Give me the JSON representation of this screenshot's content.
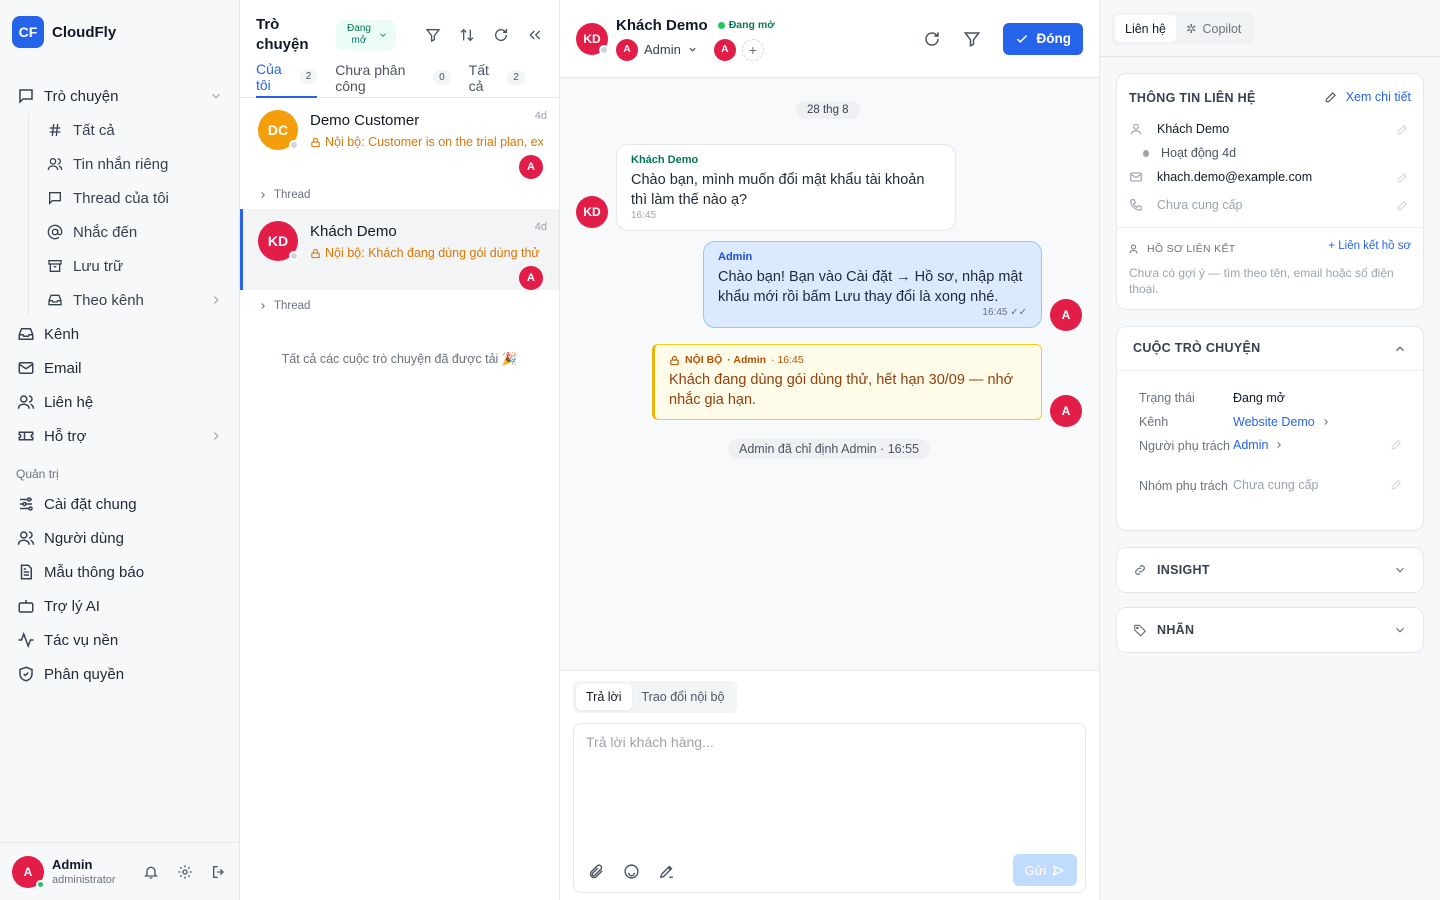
{
  "brand": {
    "logo": "CF",
    "name": "CloudFly"
  },
  "nav": {
    "conversations": "Trò chuyện",
    "sub": [
      {
        "icon": "hash-icon",
        "label": "Tất cả"
      },
      {
        "icon": "users-icon",
        "label": "Tin nhắn riêng"
      },
      {
        "icon": "thread-icon",
        "label": "Thread của tôi"
      },
      {
        "icon": "at-icon",
        "label": "Nhắc đến"
      },
      {
        "icon": "archive-icon",
        "label": "Lưu trữ"
      },
      {
        "icon": "inbox-icon",
        "label": "Theo kênh"
      }
    ],
    "items": [
      {
        "icon": "inbox-icon",
        "label": "Kênh"
      },
      {
        "icon": "mail-icon",
        "label": "Email"
      },
      {
        "icon": "contacts-icon",
        "label": "Liên hệ"
      },
      {
        "icon": "ticket-icon",
        "label": "Hỗ trợ"
      }
    ],
    "admin_section": "Quản trị",
    "admin_items": [
      {
        "icon": "sliders-icon",
        "label": "Cài đặt chung"
      },
      {
        "icon": "users-icon",
        "label": "Người dùng"
      },
      {
        "icon": "template-icon",
        "label": "Mẫu thông báo"
      },
      {
        "icon": "bot-icon",
        "label": "Trợ lý AI"
      },
      {
        "icon": "activity-icon",
        "label": "Tác vụ nền"
      },
      {
        "icon": "shield-icon",
        "label": "Phân quyền"
      }
    ]
  },
  "user": {
    "initial": "A",
    "name": "Admin",
    "role": "administrator"
  },
  "list": {
    "title": "Trò chuyện",
    "status_filter": "Đang mở",
    "tabs": [
      {
        "label": "Của tôi",
        "count": "2"
      },
      {
        "label": "Chưa phân công",
        "count": "0"
      },
      {
        "label": "Tất cả",
        "count": "2"
      }
    ],
    "conversations": [
      {
        "initials": "DC",
        "name": "Demo Customer",
        "preview": "Nội bộ: Customer is on the trial plan, ex",
        "time": "4d",
        "assignee": "A",
        "color": "#f59e0b"
      },
      {
        "initials": "KD",
        "name": "Khách Demo",
        "preview": "Nội bộ: Khách đang dùng gói dùng thử",
        "time": "4d",
        "assignee": "A",
        "color": "#e11d48"
      }
    ],
    "thread_label": "Thread",
    "all_loaded": "Tất cả các cuộc trò chuyện đã được tải 🎉"
  },
  "chat": {
    "initials": "KD",
    "name": "Khách Demo",
    "status": "Đang mở",
    "assignee_initial": "A",
    "assignee_name": "Admin",
    "participant_initial": "A",
    "close_label": "Đóng",
    "date_chip": "28 thg 8",
    "incoming": {
      "author": "Khách Demo",
      "text": "Chào bạn, mình muốn đổi mật khẩu tài khoản thì làm thế nào ạ?",
      "time": "16:45"
    },
    "outgoing": {
      "author": "Admin",
      "text": "Chào bạn! Bạn vào Cài đặt → Hồ sơ, nhập mật khẩu mới rồi bấm Lưu thay đổi là xong nhé.",
      "time": "16:45"
    },
    "note": {
      "tag": "NỘI BỘ",
      "author": "· Admin",
      "time": "· 16:45",
      "text": "Khách đang dùng gói dùng thử, hết hạn 30/09 — nhớ nhắc gia hạn."
    },
    "system": "Admin đã chỉ định Admin · 16:55",
    "composer": {
      "tab_reply": "Trả lời",
      "tab_internal": "Trao đổi nội bộ",
      "placeholder": "Trả lời khách hàng...",
      "send_label": "Gửi"
    }
  },
  "panel": {
    "tabs": [
      "Liên hệ",
      "Copilot"
    ],
    "contact": {
      "title": "THÔNG TIN LIÊN HỆ",
      "detail_link": "Xem chi tiết",
      "name": "Khách Demo",
      "activity": "Hoạt động 4d",
      "email": "khach.demo@example.com",
      "phone": "Chưa cung cấp",
      "linked_title": "HỒ SƠ LIÊN KẾT",
      "link_action": "+ Liên kết hồ sơ",
      "linked_hint": "Chưa có gợi ý — tìm theo tên, email hoặc số điện thoại."
    },
    "conversation": {
      "title": "CUỘC TRÒ CHUYỆN",
      "rows": [
        {
          "label": "Trạng thái",
          "value": "Đang mở"
        },
        {
          "label": "Kênh",
          "value": "Website Demo"
        },
        {
          "label": "Người phụ trách",
          "value": "Admin"
        },
        {
          "label": "Nhóm phụ trách",
          "value": "Chưa cung cấp"
        }
      ]
    },
    "insight": "INSIGHT",
    "labels": "NHÃN"
  },
  "colors": {
    "primary": "#2563eb",
    "avatar": "#e11d48",
    "success": "#22c55e",
    "note": "#fefce8"
  }
}
